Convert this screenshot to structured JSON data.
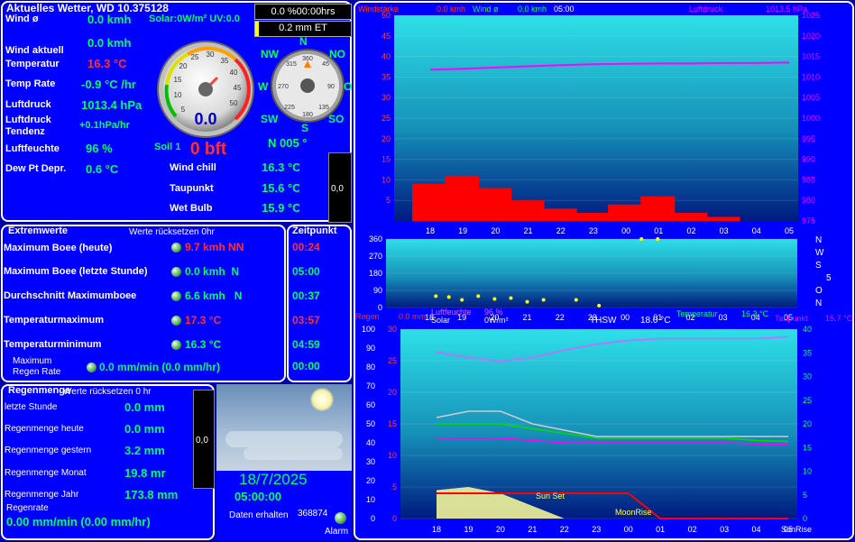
{
  "current": {
    "title": "Aktuelles Wetter, WD 10.375128",
    "rows": [
      {
        "label": "Wind ø",
        "value": "0.0 kmh"
      },
      {
        "label": "Wind aktuell",
        "value": "0.0 kmh"
      },
      {
        "label": "Temperatur",
        "value": "16.3 °C"
      },
      {
        "label": "Temp Rate",
        "value": "-0.9 °C /hr"
      },
      {
        "label": "Luftdruck",
        "value": "1013.4 hPa"
      },
      {
        "label": "Luftdruck Tendenz",
        "value": "+0.1hPa/hr"
      },
      {
        "label": "Luftfeuchte",
        "value": "96 %"
      },
      {
        "label": "Dew Pt Depr.",
        "value": "0.6 °C"
      }
    ],
    "solar_uv": "Solar:0W/m² UV:0.0",
    "soil": "Soil 1",
    "bft": "0 bft",
    "wind_dir": "N 005 °",
    "gauge_value": "0.0",
    "gauge_ticks": [
      "5",
      "10",
      "15",
      "20",
      "25",
      "30",
      "35",
      "40",
      "45",
      "50"
    ],
    "compass": {
      "N": "N",
      "NO": "NO",
      "O": "O",
      "SO": "SO",
      "S": "S",
      "SW": "SW",
      "W": "W",
      "NW": "NW"
    },
    "compass_ticks": [
      "315",
      "360",
      "45",
      "90",
      "135",
      "180",
      "225",
      "270"
    ],
    "extra": [
      {
        "label": "Wind chill",
        "value": "16.3 °C"
      },
      {
        "label": "Taupunkt",
        "value": "15.6 °C"
      },
      {
        "label": "Wet Bulb",
        "value": "15.9 °C"
      }
    ],
    "side_box_value": "0,0"
  },
  "top_buttons": {
    "time": "0.0 %00:00hrs",
    "et": "0.2 mm ET"
  },
  "extremes": {
    "title": "Extremwerte",
    "reset": "Werte rücksetzen 0hr",
    "time_title": "Zeitpunkt",
    "rows": [
      {
        "label": "Maximum Boee (heute)",
        "value": "9.7 kmh NN",
        "time": "00:24",
        "hot": true
      },
      {
        "label": "Maximum Boee (letzte Stunde)",
        "value": "0.0 kmh  N",
        "time": "05:00",
        "hot": false
      },
      {
        "label": "Durchschnitt Maximumboee",
        "value": "6.6 kmh   N",
        "time": "00:37",
        "hot": false
      },
      {
        "label": "Temperaturmaximum",
        "value": "17.3 °C",
        "time": "03:57",
        "hot": true
      },
      {
        "label": "Temperaturminimum",
        "value": "16.3 °C",
        "time": "04:59",
        "hot": false
      },
      {
        "label": "Maximum Regen Rate",
        "value": "0.0 mm/min (0.0 mm/hr)",
        "time": "00:00",
        "hot": false
      }
    ]
  },
  "rain": {
    "title": "Regenmenge",
    "reset": "Werte rücksetzen 0 hr",
    "rows": [
      {
        "label": "letzte Stunde",
        "value": "0.0 mm"
      },
      {
        "label": "Regenmenge heute",
        "value": "0.0 mm"
      },
      {
        "label": "Regenmenge gestern",
        "value": "3.2 mm"
      },
      {
        "label": "Regenmenge Monat",
        "value": "19.8 mr"
      },
      {
        "label": "Regenmenge Jahr",
        "value": "173.8 mm"
      }
    ],
    "rate_label": "Regenrate",
    "rate_value": "0.00 mm/min (0.00 mm/hr)",
    "side_box_value": "0,0"
  },
  "sky": {
    "date": "18/7/2025",
    "time": "05:00:00",
    "received_label": "Daten erhalten",
    "received_count": "368874",
    "alarm": "Alarm"
  },
  "chart_data": [
    {
      "type": "line",
      "title": "",
      "header": {
        "windstaerke": "Windstärke",
        "wind_now": "0.0 kmh",
        "wind_avg_label": "Wind ø",
        "wind_avg": "0.0 kmh",
        "time": "05:00",
        "pressure_label": "Luftdruck",
        "pressure": "1013.5 hPa"
      },
      "x_ticks": [
        "18",
        "19",
        "20",
        "21",
        "22",
        "23",
        "00",
        "01",
        "02",
        "03",
        "04",
        "05"
      ],
      "y_left_ticks": [
        "5",
        "10",
        "15",
        "20",
        "25",
        "30",
        "35",
        "40",
        "45",
        "50"
      ],
      "y_right_ticks": [
        "975",
        "980",
        "985",
        "990",
        "995",
        "1000",
        "1005",
        "1010",
        "1015",
        "1020",
        "1025"
      ],
      "ylim_left": [
        0,
        50
      ],
      "ylim_right": [
        975,
        1025
      ],
      "series": [
        {
          "name": "Luftdruck",
          "color": "#ff00ff",
          "axis": "right",
          "values": [
            1011.8,
            1012.0,
            1012.3,
            1012.6,
            1012.9,
            1013.1,
            1013.2,
            1013.3,
            1013.3,
            1013.4,
            1013.4,
            1013.5
          ]
        },
        {
          "name": "Windstärke",
          "color": "#ff0000",
          "axis": "left",
          "values": [
            9,
            11,
            8,
            5,
            3,
            2,
            4,
            6,
            2,
            1,
            0,
            0
          ]
        }
      ]
    },
    {
      "type": "scatter",
      "title": "",
      "x_ticks": [
        "18",
        "19",
        "20",
        "21",
        "22",
        "23",
        "00",
        "01",
        "02",
        "03",
        "04",
        "05"
      ],
      "y_ticks": [
        "0",
        "90",
        "180",
        "270",
        "360"
      ],
      "right_labels": [
        "N",
        "W",
        "S",
        "5",
        "O",
        "N"
      ],
      "ylim": [
        0,
        360
      ],
      "series": [
        {
          "name": "",
          "color": "#ffff00",
          "x": [
            0.2,
            0.6,
            1.0,
            1.5,
            2.0,
            2.5,
            3.0,
            3.5,
            4.5,
            5.2,
            6.5,
            7.0
          ],
          "values": [
            60,
            55,
            40,
            60,
            45,
            50,
            30,
            40,
            40,
            10,
            360,
            360
          ]
        }
      ]
    },
    {
      "type": "line",
      "title": "",
      "header": {
        "regen_label": "Regen",
        "regen": "0.0 mm",
        "feuchte_label": "Luftfeuchte",
        "feuchte": "96 %",
        "solar_label": "Solar",
        "solar": "0W/m²",
        "thsw_label": "THSW",
        "thsw": "18.0 °C",
        "temp_label": "Temperatur",
        "temp": "16.3 °C",
        "taupunkt_label": "Taupunkt",
        "taupunkt": "15.7 °C"
      },
      "annotations": {
        "sunset": "Sun Set",
        "moonrise": "MoonRise",
        "sunrise": "SunRise"
      },
      "x_ticks": [
        "18",
        "19",
        "20",
        "21",
        "22",
        "23",
        "00",
        "01",
        "02",
        "03",
        "04",
        "05"
      ],
      "y_left_ticks": [
        "0",
        "10",
        "20",
        "30",
        "40",
        "50",
        "60",
        "70",
        "80",
        "90",
        "100"
      ],
      "y_mid_ticks": [
        "0",
        "5",
        "10",
        "15",
        "20",
        "25",
        "30"
      ],
      "y_right_ticks": [
        "0",
        "5",
        "10",
        "15",
        "20",
        "25",
        "30",
        "35",
        "40"
      ],
      "series": [
        {
          "name": "Luftfeuchte",
          "color": "#cc66ff",
          "axis": "left",
          "values": [
            88,
            85,
            83,
            85,
            89,
            92,
            94,
            95,
            95,
            95,
            95,
            96
          ]
        },
        {
          "name": "THSW",
          "color": "#cccccc",
          "axis": "mid",
          "values": [
            16,
            17,
            17,
            15,
            14,
            13,
            13,
            13,
            13,
            13,
            13,
            13
          ]
        },
        {
          "name": "Temperatur",
          "color": "#00dd00",
          "axis": "right",
          "values": [
            20,
            20,
            20,
            19,
            18,
            17,
            17,
            17,
            17,
            17,
            16.5,
            16.3
          ]
        },
        {
          "name": "Taupunkt",
          "color": "#ff00ff",
          "axis": "right",
          "values": [
            17,
            17,
            17,
            16.5,
            16,
            16,
            16,
            16,
            16,
            16,
            15.8,
            15.7
          ]
        },
        {
          "name": "Solar",
          "color": "#ffff99",
          "axis": "mid",
          "values": [
            4.5,
            5,
            4,
            2,
            0,
            0,
            0,
            0,
            0,
            0,
            0,
            0
          ]
        },
        {
          "name": "Regen",
          "color": "#ff0000",
          "axis": "mid",
          "values": [
            4,
            4,
            4,
            4,
            4,
            4,
            4,
            0,
            0,
            0,
            0,
            0
          ]
        }
      ]
    }
  ]
}
